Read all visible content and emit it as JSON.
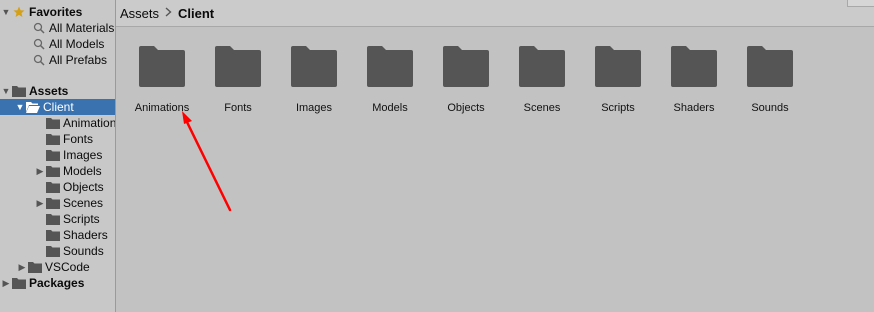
{
  "sidebar": {
    "favorites": {
      "label": "Favorites",
      "items": [
        {
          "label": "All Materials"
        },
        {
          "label": "All Models"
        },
        {
          "label": "All Prefabs"
        }
      ]
    },
    "assets": {
      "label": "Assets",
      "client": {
        "label": "Client",
        "children": [
          {
            "label": "Animations"
          },
          {
            "label": "Fonts"
          },
          {
            "label": "Images"
          },
          {
            "label": "Models"
          },
          {
            "label": "Objects"
          },
          {
            "label": "Scenes"
          },
          {
            "label": "Scripts"
          },
          {
            "label": "Shaders"
          },
          {
            "label": "Sounds"
          }
        ]
      },
      "vscode": {
        "label": "VSCode"
      }
    },
    "packages": {
      "label": "Packages"
    }
  },
  "breadcrumb": {
    "root": "Assets",
    "current": "Client"
  },
  "folders": [
    {
      "label": "Animations"
    },
    {
      "label": "Fonts"
    },
    {
      "label": "Images"
    },
    {
      "label": "Models"
    },
    {
      "label": "Objects"
    },
    {
      "label": "Scenes"
    },
    {
      "label": "Scripts"
    },
    {
      "label": "Shaders"
    },
    {
      "label": "Sounds"
    }
  ],
  "colors": {
    "selection": "#3a72b0",
    "folder": "#555555",
    "annotation_arrow": "#ff0000",
    "star": "#d4a017"
  },
  "icons": {
    "favorites": "star-icon",
    "search": "search-icon",
    "folder": "folder-icon",
    "folder_open": "open-folder-icon"
  }
}
